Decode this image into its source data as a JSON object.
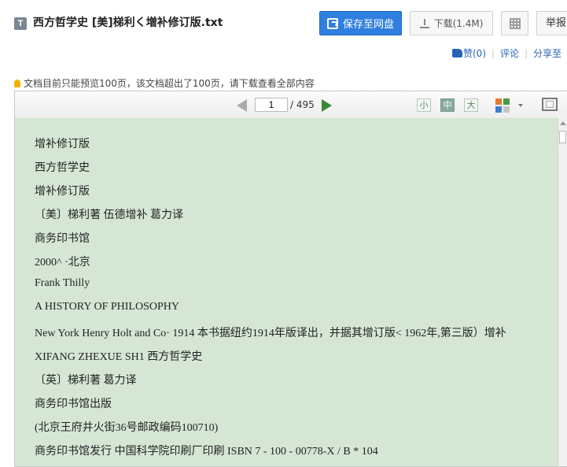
{
  "header": {
    "file_badge": "T",
    "title": "西方哲学史 [美]梯利く増补修订版.txt",
    "save_button": "保存至网盘",
    "download_button": "下载(1.4M)",
    "report_button": "举报"
  },
  "actions": {
    "like": "赞(0)",
    "comment": "评论",
    "share": "分享至"
  },
  "notice": "文档目前只能预览100页，该文档超出了100页，请下载查看全部内容",
  "toolbar": {
    "page_current": "1",
    "page_total": "/ 495",
    "size_small": "小",
    "size_medium": "中",
    "size_large": "大"
  },
  "lines": [
    "增补修订版",
    "西方哲学史",
    "增补修订版",
    "〔美〕梯利著 伍德增补 葛力译",
    "商务印书馆",
    "2000^ ·北京",
    "Frank Thilly",
    "A HISTORY OF PHILOSOPHY",
    "New York Henry Holt and Co· 1914 本书据纽约1914年版译出，并据其增订版< 1962年,第三版）增补",
    "XIFANG ZHEXUE SH1 西方哲学史",
    "〔英〕梯利著 葛力译",
    "商务印书馆出版",
    "(北京王府井火街36号邮政编码100710)",
    "商务印书馆发行 中国科学院印刷厂印刷 ISBN 7 - 100 - 00778-X / B * 104"
  ]
}
